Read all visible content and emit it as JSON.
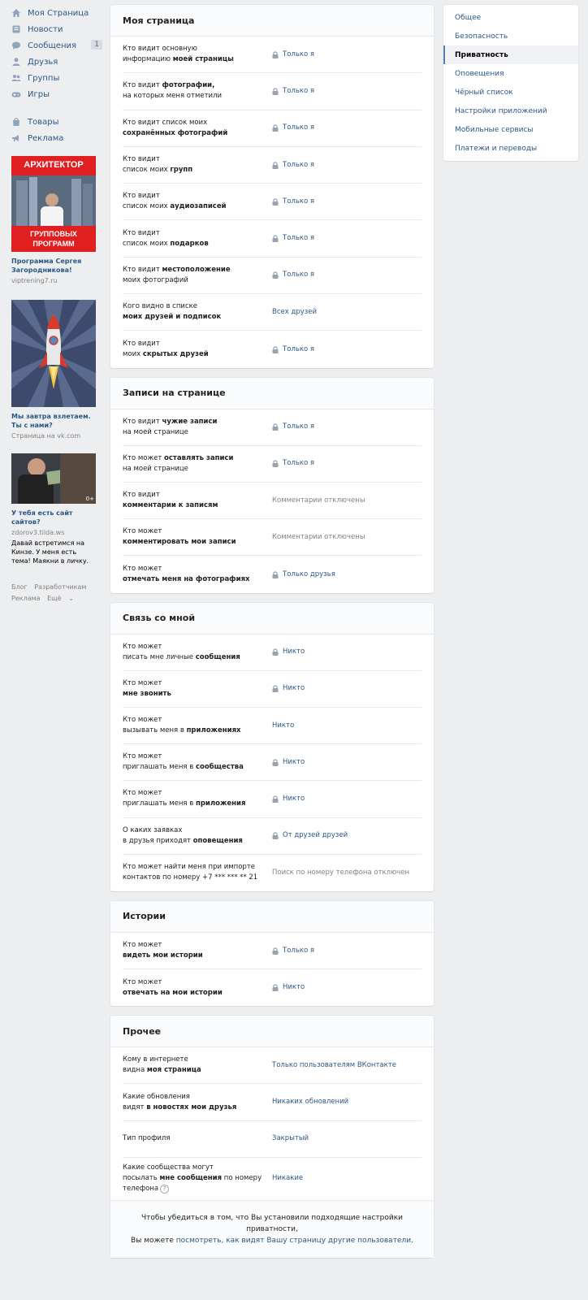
{
  "left_nav": {
    "items": [
      {
        "label": "Моя Страница",
        "icon": "home-icon"
      },
      {
        "label": "Новости",
        "icon": "news-icon"
      },
      {
        "label": "Сообщения",
        "icon": "messages-icon",
        "badge": "1"
      },
      {
        "label": "Друзья",
        "icon": "friends-icon"
      },
      {
        "label": "Группы",
        "icon": "groups-icon"
      },
      {
        "label": "Игры",
        "icon": "games-icon"
      }
    ],
    "items2": [
      {
        "label": "Товары",
        "icon": "goods-icon"
      },
      {
        "label": "Реклама",
        "icon": "ads-icon"
      }
    ]
  },
  "ads": [
    {
      "banner_top": "АРХИТЕКТОР",
      "banner_bottom": "ГРУППОВЫХ ПРОГРАММ",
      "title": "Программа Сергея Загородникова!",
      "sub": "viptrening7.ru"
    },
    {
      "title": "Мы завтра взлетаем. Ты с нами?",
      "sub": "Страница на vk.com"
    },
    {
      "badge": "0+",
      "title": "У тебя есть сайт сайтов?",
      "sub": "zdorov3.tilda.ws",
      "text": "Давай встретимся на Кинзе. У меня есть тема! Маякни в личку."
    }
  ],
  "footer": {
    "blog": "Блог",
    "dev": "Разработчикам",
    "ads": "Реклама",
    "more": "Ещё"
  },
  "sections": {
    "my_page": {
      "title": "Моя страница",
      "rows": [
        {
          "l1": "Кто видит основную",
          "l2a": "информацию ",
          "l2b": "моей страницы",
          "value": "Только я",
          "lock": true
        },
        {
          "l1a": "Кто видит ",
          "l1b": "фотографии,",
          "l2a": "на которых меня отметили",
          "l2b": "",
          "value": "Только я",
          "lock": true
        },
        {
          "l1": "Кто видит список моих",
          "l2a": "",
          "l2b": "сохранённых фотографий",
          "value": "Только я",
          "lock": true
        },
        {
          "l1": "Кто видит",
          "l2a": "список моих ",
          "l2b": "групп",
          "value": "Только я",
          "lock": true
        },
        {
          "l1": "Кто видит",
          "l2a": "список моих ",
          "l2b": "аудиозаписей",
          "value": "Только я",
          "lock": true
        },
        {
          "l1": "Кто видит",
          "l2a": "список моих ",
          "l2b": "подарков",
          "value": "Только я",
          "lock": true
        },
        {
          "l1a": "Кто видит ",
          "l1b": "местоположение",
          "l2a": "моих фотографий",
          "l2b": "",
          "value": "Только я",
          "lock": true
        },
        {
          "l1": "Кого видно в списке",
          "l2a": "",
          "l2b": "моих друзей и подписок",
          "value": "Всех друзей",
          "lock": false
        },
        {
          "l1": "Кто видит",
          "l2a": "моих ",
          "l2b": "скрытых друзей",
          "value": "Только я",
          "lock": true
        }
      ]
    },
    "wall": {
      "title": "Записи на странице",
      "rows": [
        {
          "l1a": "Кто видит ",
          "l1b": "чужие записи",
          "l2a": "на моей странице",
          "l2b": "",
          "value": "Только я",
          "lock": true
        },
        {
          "l1a": "Кто может ",
          "l1b": "оставлять записи",
          "l2a": "на моей странице",
          "l2b": "",
          "value": "Только я",
          "lock": true
        },
        {
          "l1": "Кто видит",
          "l2a": "",
          "l2b": "комментарии к записям",
          "value": "Комментарии отключены",
          "muted": true
        },
        {
          "l1": "Кто может",
          "l2a": "",
          "l2b": "комментировать мои записи",
          "value": "Комментарии отключены",
          "muted": true
        },
        {
          "l1": "Кто может",
          "l2a": "",
          "l2b": "отмечать меня на фотографиях",
          "value": "Только друзья",
          "lock": true
        }
      ]
    },
    "contact": {
      "title": "Связь со мной",
      "rows": [
        {
          "l1": "Кто может",
          "l2a": "писать мне личные ",
          "l2b": "сообщения",
          "value": "Никто",
          "lock": true
        },
        {
          "l1": "Кто может",
          "l2a": "",
          "l2b": "мне звонить",
          "value": "Никто",
          "lock": true
        },
        {
          "l1": "Кто может",
          "l2a": "вызывать меня в ",
          "l2b": "приложениях",
          "value": "Никто",
          "lock": false
        },
        {
          "l1": "Кто может",
          "l2a": "приглашать меня в ",
          "l2b": "сообщества",
          "value": "Никто",
          "lock": true
        },
        {
          "l1": "Кто может",
          "l2a": "приглашать меня в ",
          "l2b": "приложения",
          "value": "Никто",
          "lock": true
        },
        {
          "l1": "О каких заявках",
          "l2a": "в друзья приходят ",
          "l2b": "оповещения",
          "value": "От друзей друзей",
          "lock": true
        },
        {
          "l1": "Кто может найти меня при импорте",
          "l2a": "контактов по номеру +7 *** *** ** 21",
          "l2b": "",
          "value": "Поиск по номеру телефона отключен",
          "muted": true
        }
      ]
    },
    "stories": {
      "title": "Истории",
      "rows": [
        {
          "l1": "Кто может",
          "l2a": "",
          "l2b": "видеть мои истории",
          "value": "Только я",
          "lock": true
        },
        {
          "l1": "Кто может",
          "l2a": "",
          "l2b": "отвечать на мои истории",
          "value": "Никто",
          "lock": true
        }
      ]
    },
    "other": {
      "title": "Прочее",
      "rows": [
        {
          "l1": "Кому в интернете",
          "l2a": "видна ",
          "l2b": "моя страница",
          "value": "Только пользователям ВКонтакте",
          "lock": false
        },
        {
          "l1": "Какие обновления",
          "l2a": "видят ",
          "l2b": "в новостях мои друзья",
          "value": "Никаких обновлений",
          "lock": false
        },
        {
          "l1": "Тип профиля",
          "l2a": "",
          "l2b": "",
          "value": "Закрытый",
          "lock": false
        },
        {
          "l1": "Какие сообщества могут",
          "l2a": "посылать ",
          "l2b": "мне сообщения",
          "l2c": " по номеру",
          "l3": "телефона",
          "help": "?",
          "value": "Никакие",
          "lock": false
        }
      ],
      "footer_text": "Чтобы убедиться в том, что Вы установили подходящие настройки приватности,",
      "footer_text2": "Вы можете ",
      "footer_link": "посмотреть, как видят Вашу страницу другие пользователи",
      "footer_end": "."
    }
  },
  "right_menu": [
    {
      "label": "Общее"
    },
    {
      "label": "Безопасность"
    },
    {
      "label": "Приватность",
      "active": true
    },
    {
      "label": "Оповещения"
    },
    {
      "label": "Чёрный список"
    },
    {
      "label": "Настройки приложений"
    },
    {
      "label": "Мобильные сервисы"
    },
    {
      "label": "Платежи и переводы"
    }
  ],
  "colors": {
    "accent": "#2a5885",
    "bg": "#edeef0",
    "muted": "#828282"
  }
}
